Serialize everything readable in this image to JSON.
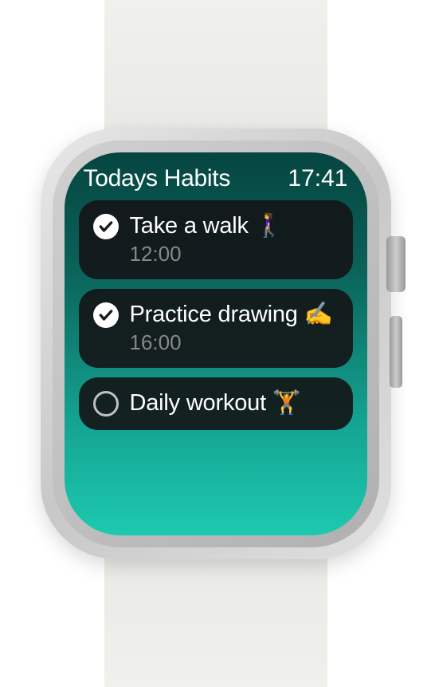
{
  "header": {
    "title": "Todays Habits",
    "time": "17:41"
  },
  "habits": [
    {
      "completed": true,
      "title": "Take a walk 🚶‍♀️",
      "time": "12:00"
    },
    {
      "completed": true,
      "title": "Practice drawing ✍️",
      "time": "16:00"
    },
    {
      "completed": false,
      "title": "Daily workout 🏋️",
      "time": ""
    }
  ]
}
